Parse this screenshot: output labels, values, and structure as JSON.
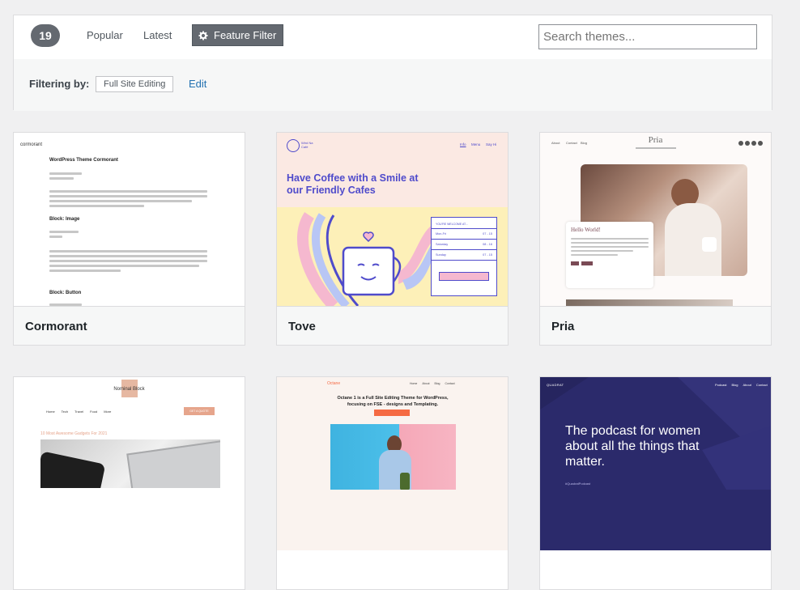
{
  "toolbar": {
    "count": "19",
    "popular_label": "Popular",
    "latest_label": "Latest",
    "feature_filter_label": "Feature Filter",
    "search_placeholder": "Search themes..."
  },
  "filter": {
    "label": "Filtering by:",
    "tag": "Full Site Editing",
    "edit_label": "Edit"
  },
  "themes": [
    {
      "name": "Cormorant",
      "preview": {
        "site_title": "cormorant",
        "post_title": "WordPress Theme Cormorant",
        "h_block_image": "Block: Image",
        "h_block_button": "Block: Button"
      }
    },
    {
      "name": "Tove",
      "preview": {
        "logo": "Wird Na Café",
        "nav": [
          "Info",
          "Menu",
          "Say Hi"
        ],
        "headline": "Have Coffee with a Smile at our Friendly Cafes",
        "hours_title": "YOU'RE WELCOME AT...",
        "hours": [
          {
            "day": "Mon-Fri",
            "time": "07 - 15"
          },
          {
            "day": "Saturday",
            "time": "08 - 16"
          },
          {
            "day": "Sunday",
            "time": "07 - 15"
          }
        ]
      }
    },
    {
      "name": "Pria",
      "preview": {
        "title": "Pria",
        "nav": [
          "About",
          "Contact",
          "Blog"
        ],
        "hello": "Hello World!"
      }
    },
    {
      "name": "Nominal Block",
      "preview": {
        "logo": "Nominal Block",
        "nav": [
          "Home",
          "Tech",
          "Travel",
          "Food",
          "More"
        ],
        "cta": "GET A QUOTE",
        "post_title": "10 Most Awesome Gadgets For 2021"
      }
    },
    {
      "name": "Octane",
      "preview": {
        "logo": "Octane",
        "nav": [
          "Home",
          "About",
          "Blog",
          "Contact"
        ],
        "headline": "Octane 1 is a Full Site Editing Theme for WordPress, focusing on FSE - designs and Templating."
      }
    },
    {
      "name": "Quadrat",
      "preview": {
        "logo": "QUADRAT",
        "nav": [
          "Podcast",
          "Blog",
          "About",
          "Contact"
        ],
        "headline": "The podcast for women about all the things that matter.",
        "hashtag": "#QuadratPodcast"
      }
    }
  ],
  "colors": {
    "count_bg": "#646970",
    "link_blue": "#2271b1",
    "tove_purple": "#4f4bcb",
    "quadrat_bg": "#2b2a6b",
    "octane_orange": "#f56a43"
  }
}
